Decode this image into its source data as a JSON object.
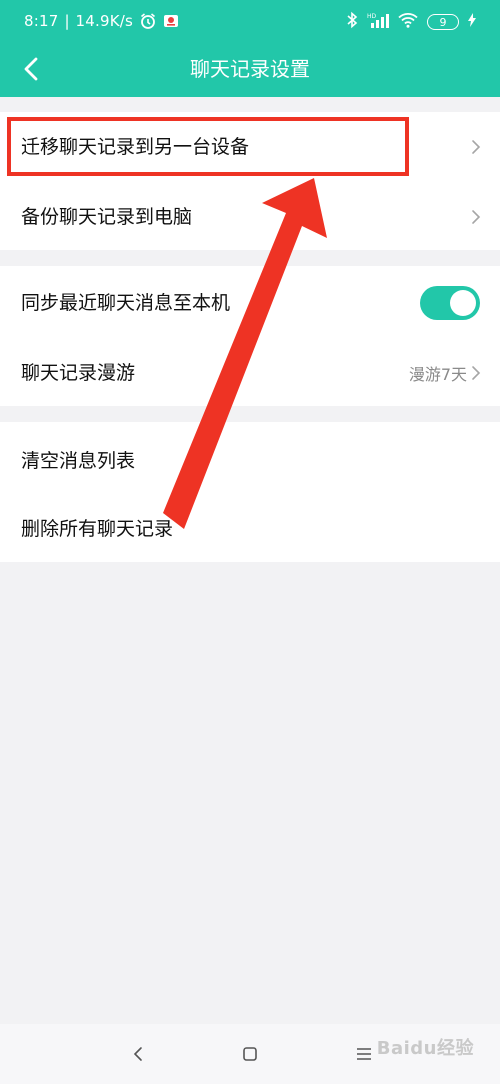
{
  "status_bar": {
    "time": "8:17",
    "separator": "|",
    "speed": "14.9K/s",
    "battery": "9",
    "icons": [
      "alarm-icon",
      "notification-icon",
      "bluetooth-icon",
      "signal-icon",
      "wifi-icon",
      "charging-icon"
    ]
  },
  "header": {
    "title": "聊天记录设置",
    "back_icon": "chevron-left-icon",
    "background": "#22c7a9"
  },
  "groups": [
    {
      "rows": [
        {
          "label": "迁移聊天记录到另一台设备",
          "trailing": "chevron"
        },
        {
          "label": "备份聊天记录到电脑",
          "trailing": "chevron"
        }
      ]
    },
    {
      "rows": [
        {
          "label": "同步最近聊天消息至本机",
          "trailing": "toggle",
          "toggle_on": true
        },
        {
          "label": "聊天记录漫游",
          "value": "漫游7天",
          "trailing": "chevron"
        }
      ]
    },
    {
      "rows": [
        {
          "label": "清空消息列表"
        },
        {
          "label": "删除所有聊天记录"
        }
      ]
    }
  ],
  "annotation": {
    "highlight_color": "#ee3324",
    "target": "迁移聊天记录到另一台设备"
  },
  "bottom_nav": {
    "icons": [
      "back-icon",
      "home-icon",
      "menu-icon"
    ]
  },
  "watermark": "Baidu经验"
}
